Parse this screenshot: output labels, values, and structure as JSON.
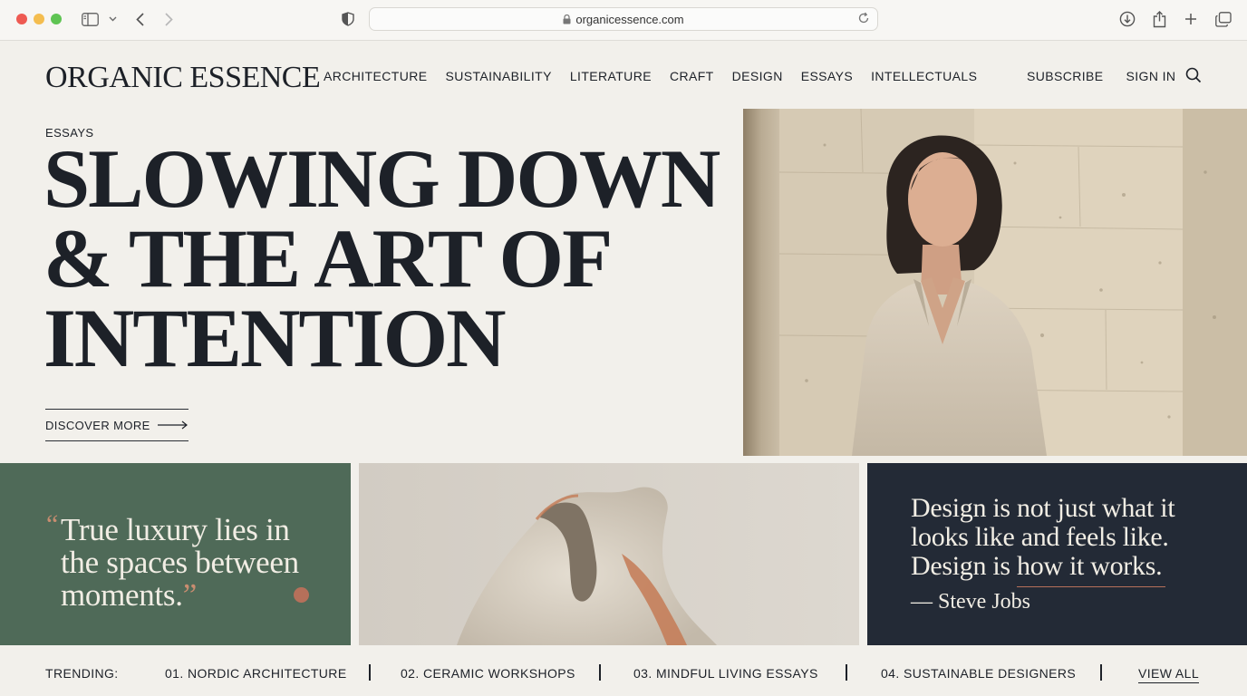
{
  "browser": {
    "url": "organicessence.com"
  },
  "site": {
    "logo": "ORGANIC ESSENCE",
    "nav": [
      "ARCHITECTURE",
      "SUSTAINABILITY",
      "LITERATURE",
      "CRAFT",
      "DESIGN",
      "ESSAYS",
      "INTELLECTUALS"
    ],
    "subscribe": "SUBSCRIBE",
    "sign_in": "SIGN IN"
  },
  "hero": {
    "kicker": "ESSAYS",
    "headline_line1": "SLOWING DOWN",
    "headline_line2": "& THE ART OF",
    "headline_line3": "INTENTION",
    "cta": "DISCOVER MORE"
  },
  "quote_card": {
    "open_quote": "“",
    "text": "True luxury lies in the spaces between moments.",
    "close_quote": "”"
  },
  "jobs_card": {
    "quote": "Design is not just what it looks like and feels like. Design is how it works.",
    "author": "— Steve Jobs"
  },
  "trending": {
    "label": "TRENDING:",
    "items": [
      "01. NORDIC ARCHITECTURE",
      "02. CERAMIC WORKSHOPS",
      "03. MINDFUL LIVING ESSAYS",
      "04. SUSTAINABLE DESIGNERS"
    ],
    "view_all": "VIEW ALL"
  },
  "colors": {
    "background": "#f2f0eb",
    "ink": "#1d2128",
    "green_card": "#4f6a58",
    "navy_card": "#232a36",
    "terracotta_accent": "#b6705a"
  },
  "icons": [
    "sidebar-icon",
    "chevron-down-icon",
    "back-arrow-icon",
    "forward-arrow-icon",
    "shield-icon",
    "lock-icon",
    "reload-icon",
    "download-icon",
    "share-icon",
    "new-tab-icon",
    "tabs-overview-icon",
    "search-icon",
    "arrow-right-icon"
  ]
}
